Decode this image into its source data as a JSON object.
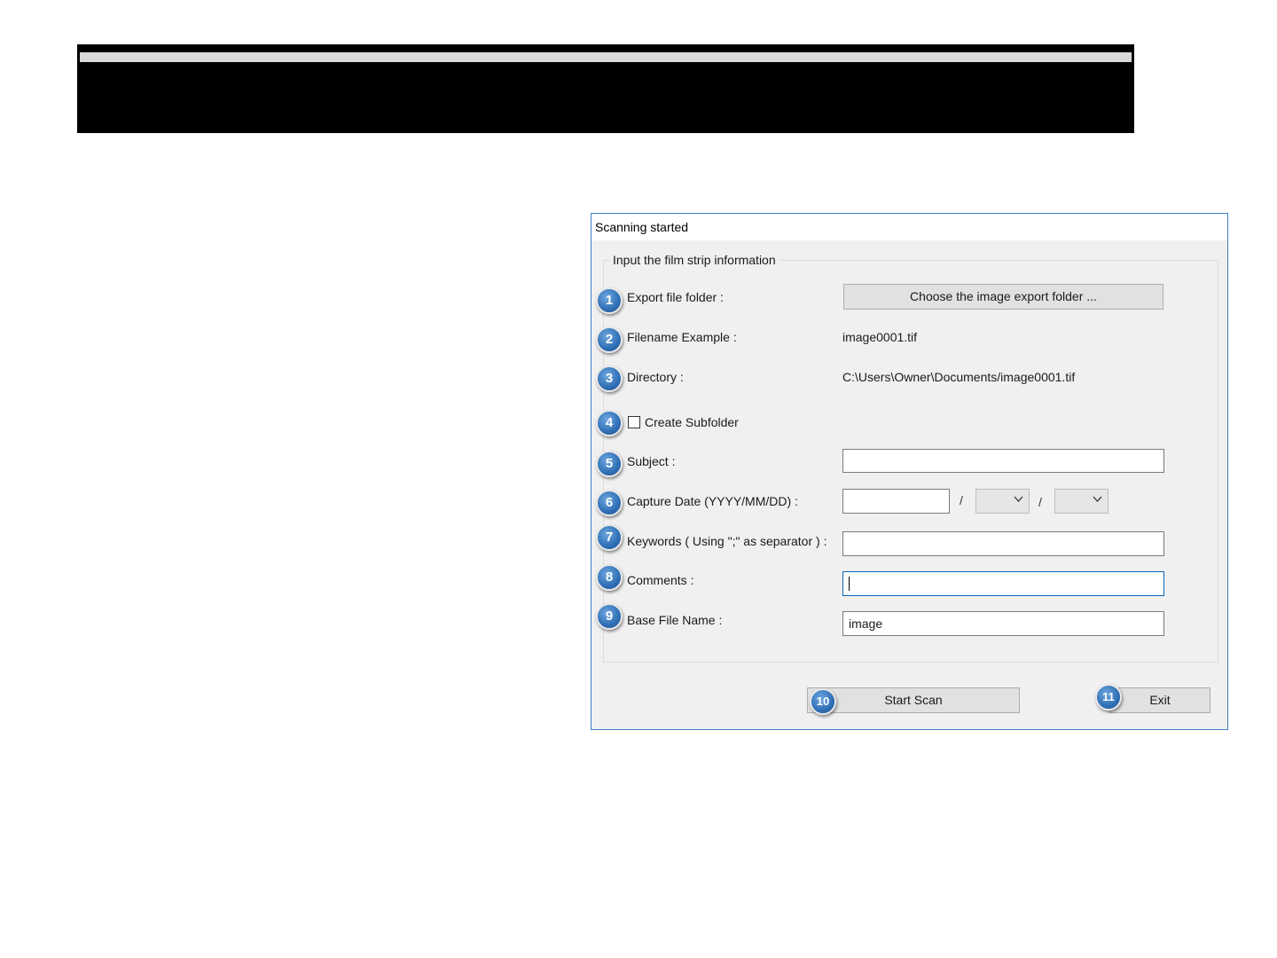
{
  "dialog": {
    "title": "Scanning started",
    "group_title": "Input the film strip information",
    "export_folder": {
      "badge": "1",
      "label": "Export file folder :",
      "button": "Choose the image export folder ..."
    },
    "filename_example": {
      "badge": "2",
      "label": "Filename Example :",
      "value": "image0001.tif"
    },
    "directory": {
      "badge": "3",
      "label": "Directory :",
      "value": "C:\\Users\\Owner\\Documents/image0001.tif"
    },
    "create_subfolder": {
      "badge": "4",
      "label": "Create Subfolder",
      "checked": false
    },
    "subject": {
      "badge": "5",
      "label": "Subject :",
      "value": ""
    },
    "capture_date": {
      "badge": "6",
      "label": "Capture Date (YYYY/MM/DD) :",
      "year": "",
      "month": "",
      "day": "",
      "separator": "/"
    },
    "keywords": {
      "badge": "7",
      "label": "Keywords ( Using \";\" as separator ) :",
      "value": ""
    },
    "comments": {
      "badge": "8",
      "label": "Comments :",
      "value": ""
    },
    "base_file_name": {
      "badge": "9",
      "label": "Base File Name :",
      "value": "image"
    },
    "start_scan": {
      "badge": "10",
      "label": "Start Scan"
    },
    "exit": {
      "badge": "11",
      "label": "Exit"
    }
  },
  "colors": {
    "badge": "#2f6fb5",
    "dialog_border": "#3c7fc4",
    "focus_border": "#0a64b4"
  }
}
